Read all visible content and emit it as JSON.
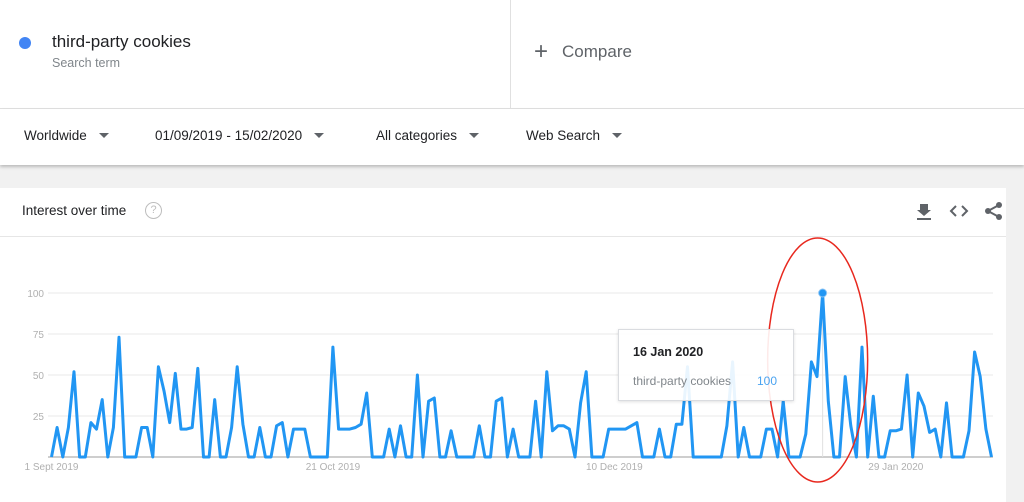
{
  "search_term": {
    "name": "third-party cookies",
    "subtitle": "Search term",
    "color": "#4285f4"
  },
  "compare": {
    "icon": "plus-icon",
    "label": "Compare"
  },
  "filters": [
    {
      "label": "Worldwide"
    },
    {
      "label": "01/09/2019 - 15/02/2020"
    },
    {
      "label": "All categories"
    },
    {
      "label": "Web Search"
    }
  ],
  "card": {
    "title": "Interest over time",
    "help_icon": "?",
    "tools": [
      "download-icon",
      "embed-icon",
      "share-icon"
    ]
  },
  "tooltip": {
    "date": "16 Jan 2020",
    "series": "third-party cookies",
    "value": "100"
  },
  "annotation": {
    "type": "ellipse",
    "color": "#e8281e"
  },
  "chart_data": {
    "type": "line",
    "series_color": "#2196f3",
    "x_start": "2019-09-01",
    "x_end": "2020-02-15",
    "x_interval": "daily",
    "ylim": [
      0,
      100
    ],
    "yticks": [
      "100",
      "75",
      "50",
      "25"
    ],
    "xticks": [
      {
        "label": "1 Sept 2019",
        "date": "2019-09-01"
      },
      {
        "label": "21 Oct 2019",
        "date": "2019-10-21"
      },
      {
        "label": "10 Dec 2019",
        "date": "2019-12-10"
      },
      {
        "label": "29 Jan 2020",
        "date": "2020-01-29"
      }
    ],
    "grid": true,
    "highlight": {
      "date": "2020-01-16",
      "value": 100
    },
    "series": [
      {
        "name": "third-party cookies",
        "values": [
          0,
          18,
          0,
          18,
          52,
          0,
          0,
          21,
          17,
          35,
          0,
          18,
          73,
          0,
          0,
          0,
          18,
          18,
          0,
          55,
          40,
          21,
          51,
          17,
          17,
          18,
          54,
          0,
          0,
          35,
          0,
          0,
          18,
          55,
          20,
          0,
          0,
          18,
          0,
          0,
          19,
          21,
          0,
          17,
          17,
          17,
          0,
          0,
          0,
          0,
          67,
          17,
          17,
          17,
          18,
          20,
          39,
          0,
          0,
          0,
          17,
          0,
          19,
          0,
          0,
          50,
          0,
          34,
          36,
          0,
          0,
          16,
          0,
          0,
          0,
          0,
          19,
          0,
          0,
          34,
          36,
          0,
          17,
          0,
          0,
          0,
          34,
          0,
          52,
          16,
          19,
          19,
          17,
          0,
          33,
          52,
          0,
          0,
          0,
          17,
          17,
          17,
          17,
          19,
          21,
          0,
          0,
          0,
          17,
          0,
          0,
          20,
          20,
          55,
          0,
          0,
          0,
          0,
          0,
          0,
          19,
          58,
          0,
          18,
          0,
          0,
          0,
          17,
          17,
          0,
          34,
          0,
          0,
          0,
          14,
          58,
          49,
          100,
          34,
          0,
          0,
          49,
          19,
          0,
          67,
          0,
          37,
          0,
          0,
          16,
          16,
          17,
          50,
          0,
          39,
          31,
          15,
          17,
          0,
          33,
          0,
          0,
          0,
          16,
          64,
          49,
          17,
          0
        ]
      }
    ]
  }
}
